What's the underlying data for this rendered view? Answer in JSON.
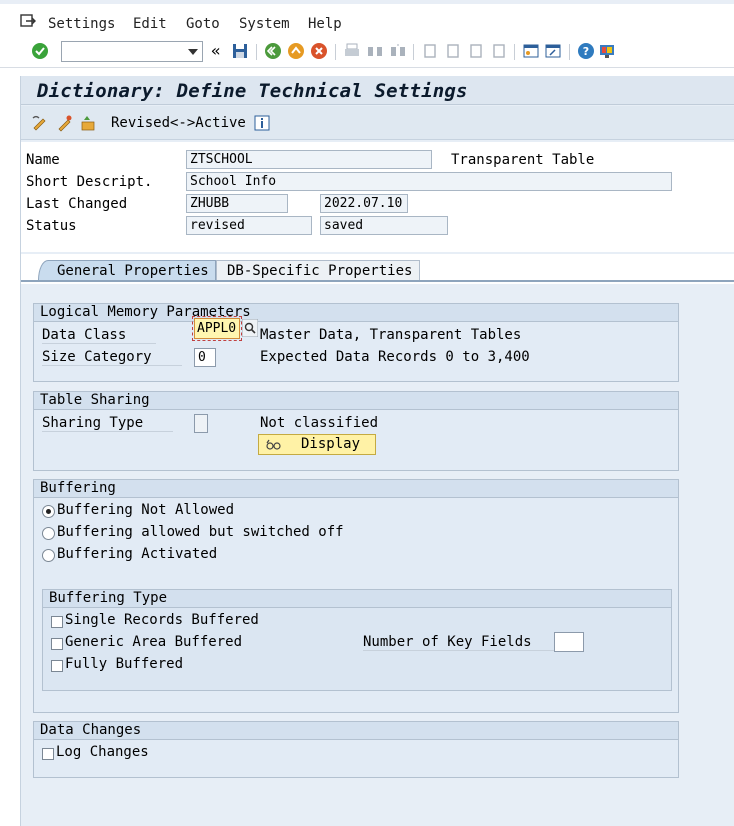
{
  "menu": {
    "items": [
      "Settings",
      "Edit",
      "Goto",
      "System",
      "Help"
    ]
  },
  "toolbar": {
    "command_value": "",
    "icons": [
      "check-icon",
      "command-dropdown",
      "double-left-icon",
      "save-icon",
      "back-icon",
      "exit-icon",
      "cancel-icon",
      "print-icon",
      "find-icon",
      "find-next-icon",
      "first-page-icon",
      "prev-page-icon",
      "next-page-icon",
      "last-page-icon",
      "new-session-icon",
      "shortcut-icon",
      "help-icon",
      "layout-icon"
    ]
  },
  "page": {
    "title": "Dictionary: Define Technical Settings",
    "revised_active": "Revised<->Active"
  },
  "header": {
    "name_label": "Name",
    "name_value": "ZTSCHOOL",
    "table_type": "Transparent Table",
    "short_desc_label": "Short Descript.",
    "short_desc_value": "School Info",
    "last_changed_label": "Last Changed",
    "last_changed_user": "ZHUBB",
    "last_changed_date": "2022.07.10",
    "status_label": "Status",
    "status_value": "revised",
    "status_saved": "saved"
  },
  "tabs": {
    "general": "General Properties",
    "db_specific": "DB-Specific Properties"
  },
  "logical_memory": {
    "title": "Logical Memory Parameters",
    "data_class_label": "Data Class",
    "data_class_value": "APPL0",
    "data_class_desc": "Master Data, Transparent Tables",
    "size_cat_label": "Size Category",
    "size_cat_value": "0",
    "size_cat_desc": "Expected Data Records 0 to 3,400"
  },
  "table_sharing": {
    "title": "Table Sharing",
    "sharing_type_label": "Sharing Type",
    "sharing_type_value": "",
    "sharing_desc": "Not classified",
    "display_btn": "Display"
  },
  "buffering": {
    "title": "Buffering",
    "options": [
      "Buffering Not Allowed",
      "Buffering allowed but switched off",
      "Buffering Activated"
    ],
    "selected": 0,
    "type_title": "Buffering Type",
    "type_options": [
      "Single Records Buffered",
      "Generic Area Buffered",
      "Fully Buffered"
    ],
    "key_fields_label": "Number of Key Fields",
    "key_fields_value": ""
  },
  "data_changes": {
    "title": "Data Changes",
    "log_changes": "Log Changes"
  },
  "colors": {
    "background": "#e7eef6",
    "group_header": "#d3e0ee",
    "focus_field": "#fff6b0",
    "button_yellow": "#fff2a6"
  }
}
